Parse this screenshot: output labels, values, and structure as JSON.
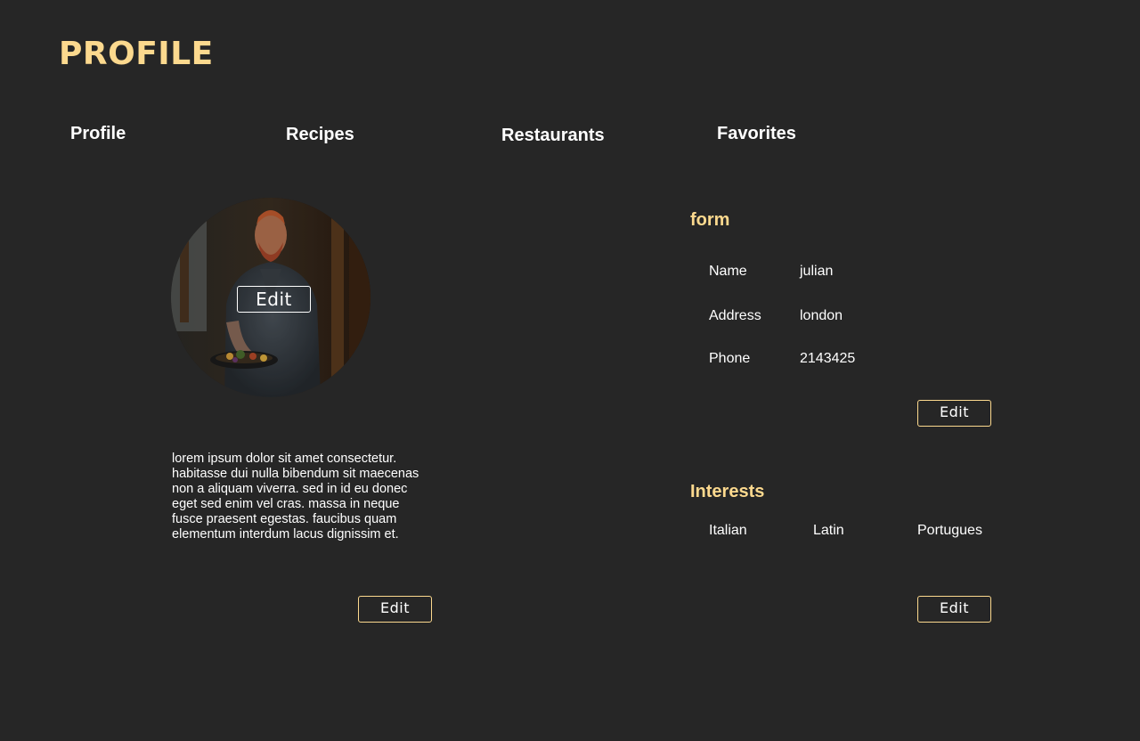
{
  "header": {
    "title": "PROFILE"
  },
  "tabs": [
    {
      "label": "Profile"
    },
    {
      "label": "Recipes"
    },
    {
      "label": "Restaurants"
    },
    {
      "label": "Favorites"
    }
  ],
  "avatar": {
    "edit_label": "Edit"
  },
  "bio": {
    "lines": [
      "lorem ipsum dolor sit amet consectetur.",
      "habitasse dui nulla bibendum sit maecenas",
      "non a aliquam viverra. sed in id eu donec",
      "eget sed enim vel cras. massa in neque",
      "fusce praesent egestas. faucibus quam",
      "elementum interdum lacus dignissim et."
    ],
    "edit_label": "Edit"
  },
  "form": {
    "title": "form",
    "fields": [
      {
        "label": "Name",
        "value": "julian"
      },
      {
        "label": "Address",
        "value": "london"
      },
      {
        "label": "Phone",
        "value": "2143425"
      }
    ],
    "edit_label": "Edit"
  },
  "interests": {
    "title": "Interests",
    "items": [
      "Italian",
      "Latin",
      "Portugues"
    ],
    "edit_label": "Edit"
  },
  "colors": {
    "background": "#262626",
    "accent": "#fcd98e",
    "text": "#ffffff"
  }
}
